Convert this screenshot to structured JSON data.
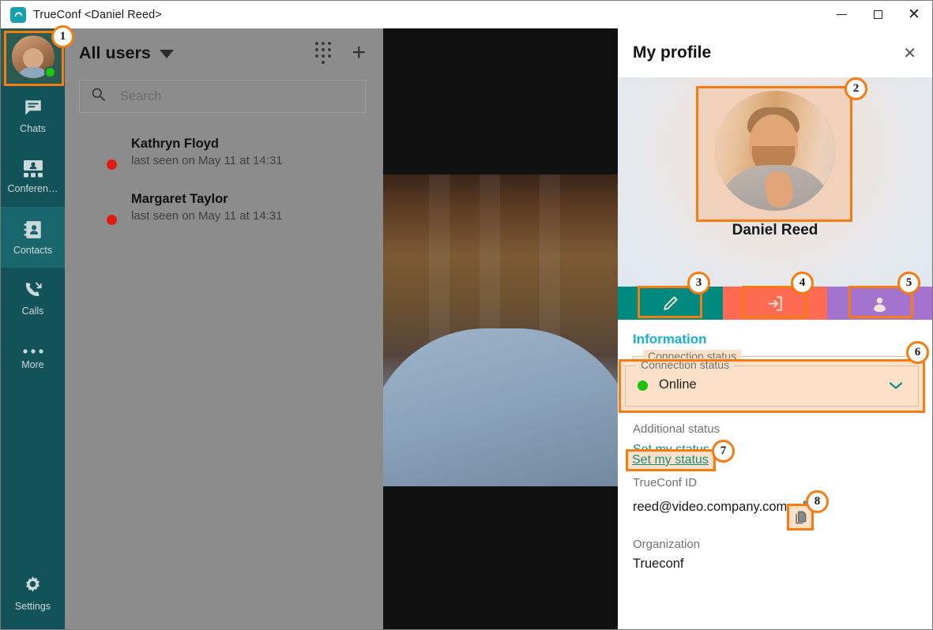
{
  "window": {
    "app_icon": "trueconf-logo-icon",
    "title": "TrueConf <Daniel Reed>",
    "minimize_label": "Minimize",
    "maximize_label": "Maximize",
    "close_label": "Close"
  },
  "sidebar": {
    "account_avatar_name": "Daniel Reed",
    "account_status": "online",
    "items": [
      {
        "label": "Chats",
        "icon": "chat-bubble-icon",
        "active": false
      },
      {
        "label": "Conferen…",
        "icon": "conference-group-icon",
        "active": false
      },
      {
        "label": "Contacts",
        "icon": "address-book-icon",
        "active": true
      },
      {
        "label": "Calls",
        "icon": "phone-call-icon",
        "active": false
      },
      {
        "label": "More",
        "icon": "ellipsis-icon",
        "active": false
      }
    ],
    "settings": {
      "label": "Settings",
      "icon": "gear-icon"
    }
  },
  "contacts_panel": {
    "group_title": "All users",
    "group_caret_icon": "caret-down-icon",
    "dialpad_icon": "dialpad-icon",
    "add_icon": "plus-icon",
    "search": {
      "placeholder": "Search",
      "value": "",
      "icon": "search-icon"
    },
    "contacts": [
      {
        "name": "Kathryn Floyd",
        "subtitle": "last seen on May 11 at 14:31",
        "status": "offline"
      },
      {
        "name": "Margaret Taylor",
        "subtitle": "last seen on May 11 at 14:31",
        "status": "offline"
      }
    ]
  },
  "profile": {
    "header_title": "My profile",
    "close_icon": "close-icon",
    "avatar_alt": "Daniel Reed avatar",
    "display_name": "Daniel Reed",
    "actions": [
      {
        "name": "edit-profile",
        "icon": "pencil-icon",
        "color": "#00897f"
      },
      {
        "name": "logout",
        "icon": "logout-arrow-icon",
        "color": "#ff6a52"
      },
      {
        "name": "change-avatar",
        "icon": "person-icon",
        "color": "#a472cf"
      }
    ],
    "information_title": "Information",
    "connection_status": {
      "legend": "Connection status",
      "value": "Online",
      "dot_color": "#1fc109",
      "chevron_icon": "chevron-down-icon"
    },
    "additional_status": {
      "label": "Additional status",
      "link_text": "Set my status"
    },
    "trueconf_id": {
      "label": "TrueConf ID",
      "value": "reed@video.company.com",
      "copy_icon": "copy-icon"
    },
    "organization": {
      "label": "Organization",
      "value": "Trueconf"
    }
  },
  "callouts": [
    {
      "number": "1",
      "target": "sidebar-account-avatar"
    },
    {
      "number": "2",
      "target": "profile-avatar"
    },
    {
      "number": "3",
      "target": "profile-edit-button"
    },
    {
      "number": "4",
      "target": "profile-logout-button"
    },
    {
      "number": "5",
      "target": "profile-avatar-button"
    },
    {
      "number": "6",
      "target": "connection-status-field"
    },
    {
      "number": "7",
      "target": "set-my-status-link"
    },
    {
      "number": "8",
      "target": "copy-trueconf-id-button"
    }
  ],
  "colors": {
    "accent_orange": "#f57c13",
    "highlight_fill": "#fde0c8",
    "sidebar_bg": "#125259",
    "info_heading": "#18b0d8",
    "link_teal": "#0e8f86"
  }
}
